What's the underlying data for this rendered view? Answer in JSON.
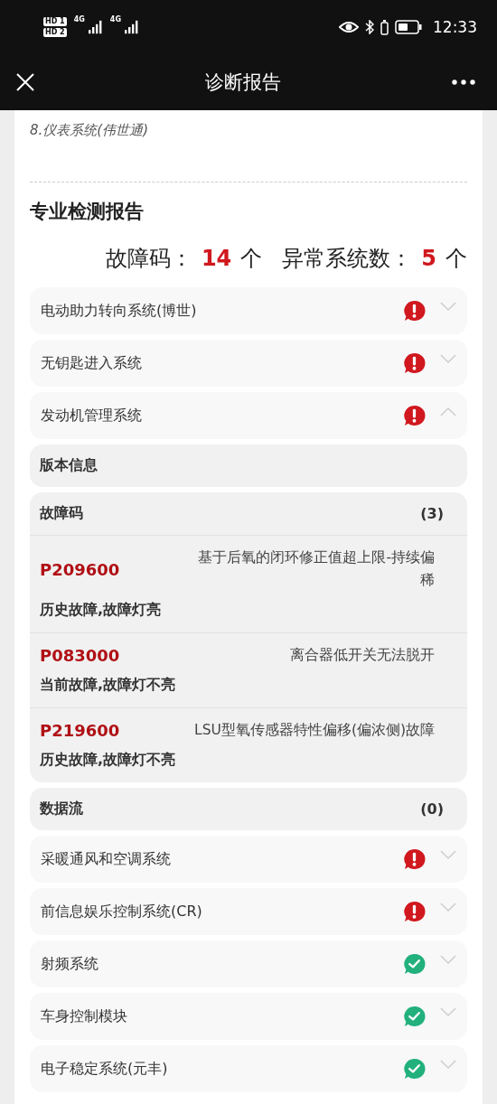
{
  "status_bar": {
    "sims": [
      "HD 1",
      "HD 2"
    ],
    "networks": [
      "4G",
      "4G"
    ],
    "time": "12:33"
  },
  "header": {
    "title": "诊断报告"
  },
  "prior_list": [
    "8.仪表系统(伟世通)"
  ],
  "report": {
    "title": "专业检测报告",
    "fault_label": "故障码：",
    "fault_count": "14",
    "fault_unit": "个",
    "system_label": "异常系统数：",
    "system_count": "5",
    "system_unit": "个"
  },
  "systems": [
    {
      "name": "电动助力转向系统(博世)",
      "kind": "fault",
      "expanded": false
    },
    {
      "name": "无钥匙进入系统",
      "kind": "fault",
      "expanded": false
    },
    {
      "name": "发动机管理系统",
      "kind": "fault",
      "expanded": true,
      "sections": [
        {
          "title": "版本信息"
        },
        {
          "title": "故障码",
          "count": "(3)",
          "codes": [
            {
              "code": "P209600",
              "description": "基于后氧的闭环修正值超上限-持续偏稀",
              "status": "历史故障,故障灯亮"
            },
            {
              "code": "P083000",
              "description": "离合器低开关无法脱开",
              "status": "当前故障,故障灯不亮"
            },
            {
              "code": "P219600",
              "description": "LSU型氧传感器特性偏移(偏浓侧)故障",
              "status": "历史故障,故障灯不亮"
            }
          ]
        },
        {
          "title": "数据流",
          "count": "(0)"
        }
      ]
    },
    {
      "name": "采暖通风和空调系统",
      "kind": "fault",
      "expanded": false
    },
    {
      "name": "前信息娱乐控制系统(CR)",
      "kind": "fault",
      "expanded": false
    },
    {
      "name": "射频系统",
      "kind": "ok",
      "expanded": false
    },
    {
      "name": "车身控制模块",
      "kind": "ok",
      "expanded": false
    },
    {
      "name": "电子稳定系统(元丰)",
      "kind": "ok",
      "expanded": false
    }
  ]
}
